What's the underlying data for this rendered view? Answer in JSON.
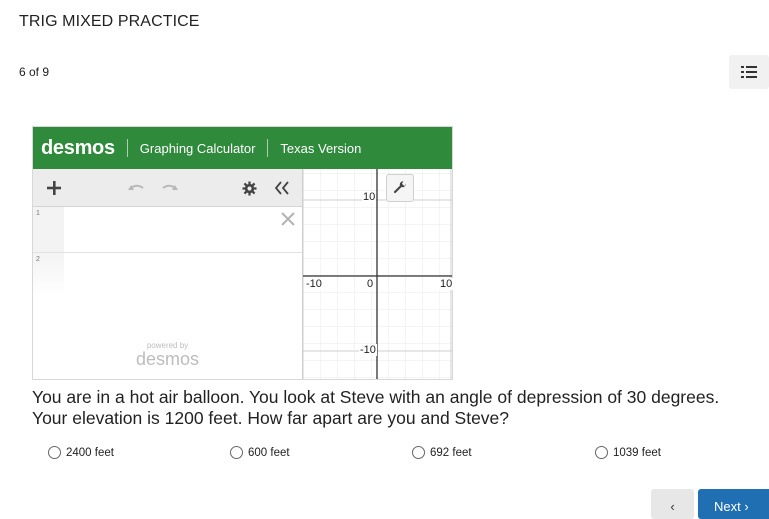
{
  "header": {
    "title": "TRIG MIXED PRACTICE",
    "progress": "6 of 9"
  },
  "icons": {
    "list": "list-icon",
    "add": "plus-icon",
    "undo": "undo-icon",
    "redo": "redo-icon",
    "settings": "gear-icon",
    "collapse": "double-chevron-left-icon",
    "delete": "close-icon",
    "wrench": "wrench-icon",
    "prev": "chevron-left-icon",
    "next": "chevron-right-icon"
  },
  "calculator": {
    "logo": "desmos",
    "product": "Graphing Calculator",
    "version": "Texas Version",
    "header_color": "#2f8a3c",
    "rows": [
      {
        "number": "1"
      },
      {
        "number": "2"
      }
    ],
    "powered_by": "powered by",
    "powered_logo": "desmos",
    "axis_labels": {
      "y_top": "10",
      "y_bottom": "-10",
      "x_left": "-10",
      "x_origin": "0",
      "x_right": "10"
    }
  },
  "question": {
    "text": "You are in a hot air balloon. You look at Steve with an angle of depression of 30 degrees. Your elevation is 1200 feet. How far apart are you and Steve?"
  },
  "choices": [
    {
      "label": "2400 feet"
    },
    {
      "label": "600 feet"
    },
    {
      "label": "692 feet"
    },
    {
      "label": "1039 feet"
    }
  ],
  "navigation": {
    "prev": "‹",
    "next": "Next ›",
    "next_color": "#1f6fb2"
  }
}
